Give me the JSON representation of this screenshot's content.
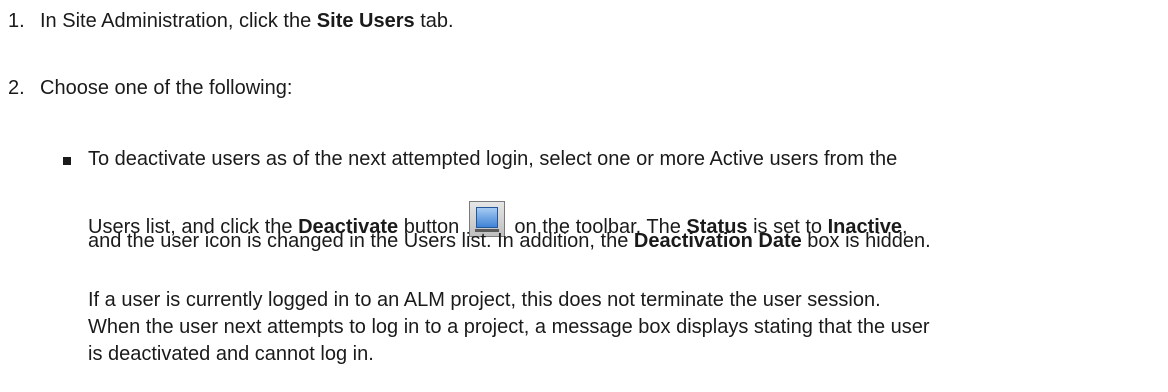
{
  "steps": [
    {
      "number": "1.",
      "pre": "In Site Administration, click the ",
      "bold": "Site Users",
      "post": " tab."
    },
    {
      "number": "2.",
      "text": "Choose one of the following:"
    }
  ],
  "bullet": {
    "line1": "To deactivate users as of the next attempted login, select one or more Active users from the",
    "line2_pre": "Users list, and click the ",
    "line2_bold1": "Deactivate",
    "line2_mid": " button ",
    "icon": "deactivate-user-icon",
    "line2_post1": " on the toolbar. The ",
    "line2_bold2": "Status",
    "line2_post2": " is set to ",
    "line2_bold3": "Inactive",
    "line2_post3": ",",
    "line3_pre": "and the user icon is changed in the Users list. In addition, the ",
    "line3_bold": "Deactivation Date",
    "line3_post": " box is hidden."
  },
  "note": {
    "line1": "If a user is currently logged in to an ALM project, this does not terminate the user session.",
    "line2": "When the user next attempts to log in to a project, a message box displays stating that the user",
    "line3": "is deactivated and cannot log in."
  }
}
